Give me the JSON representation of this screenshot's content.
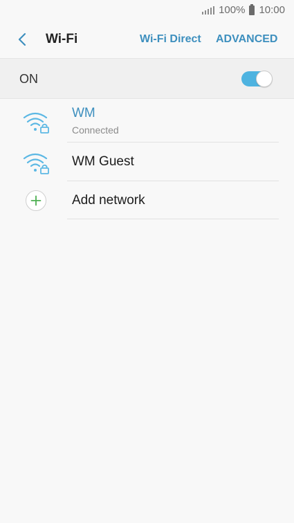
{
  "status_bar": {
    "battery_percent": "100%",
    "time": "10:00",
    "signal_icon": "signal-icon",
    "battery_icon": "battery-icon"
  },
  "header": {
    "back_icon": "back-arrow-icon",
    "title": "Wi-Fi",
    "wifi_direct_label": "Wi-Fi Direct",
    "advanced_label": "ADVANCED"
  },
  "master_switch": {
    "label": "ON",
    "state": true
  },
  "networks": [
    {
      "name": "WM",
      "status": "Connected",
      "connected": true,
      "icon": "wifi-locked-icon"
    },
    {
      "name": "WM Guest",
      "status": "",
      "connected": false,
      "icon": "wifi-locked-icon"
    }
  ],
  "add_network": {
    "label": "Add network",
    "icon": "plus-icon"
  },
  "colors": {
    "accent": "#3d8fbe",
    "toggle_on": "#4eb3e0",
    "wifi_icon": "#5cb8e4",
    "plus": "#4caf50"
  }
}
